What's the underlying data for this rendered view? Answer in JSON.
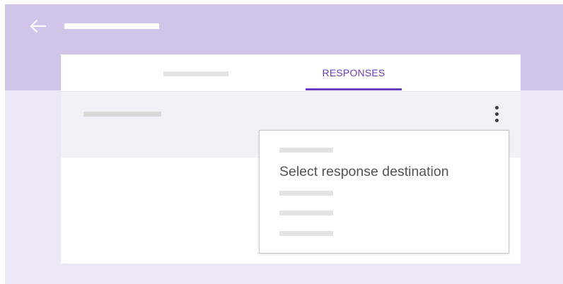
{
  "header": {
    "back_icon": "arrow-left-icon"
  },
  "tabs": {
    "active_label": "RESPONSES"
  },
  "row": {
    "more_icon": "more-vert-icon"
  },
  "menu": {
    "item_label": "Select response destination"
  },
  "colors": {
    "header_band": "#d2c4e8",
    "background": "#ece7f5",
    "accent": "#6a3dc4",
    "row_background": "#f3f1f8"
  }
}
